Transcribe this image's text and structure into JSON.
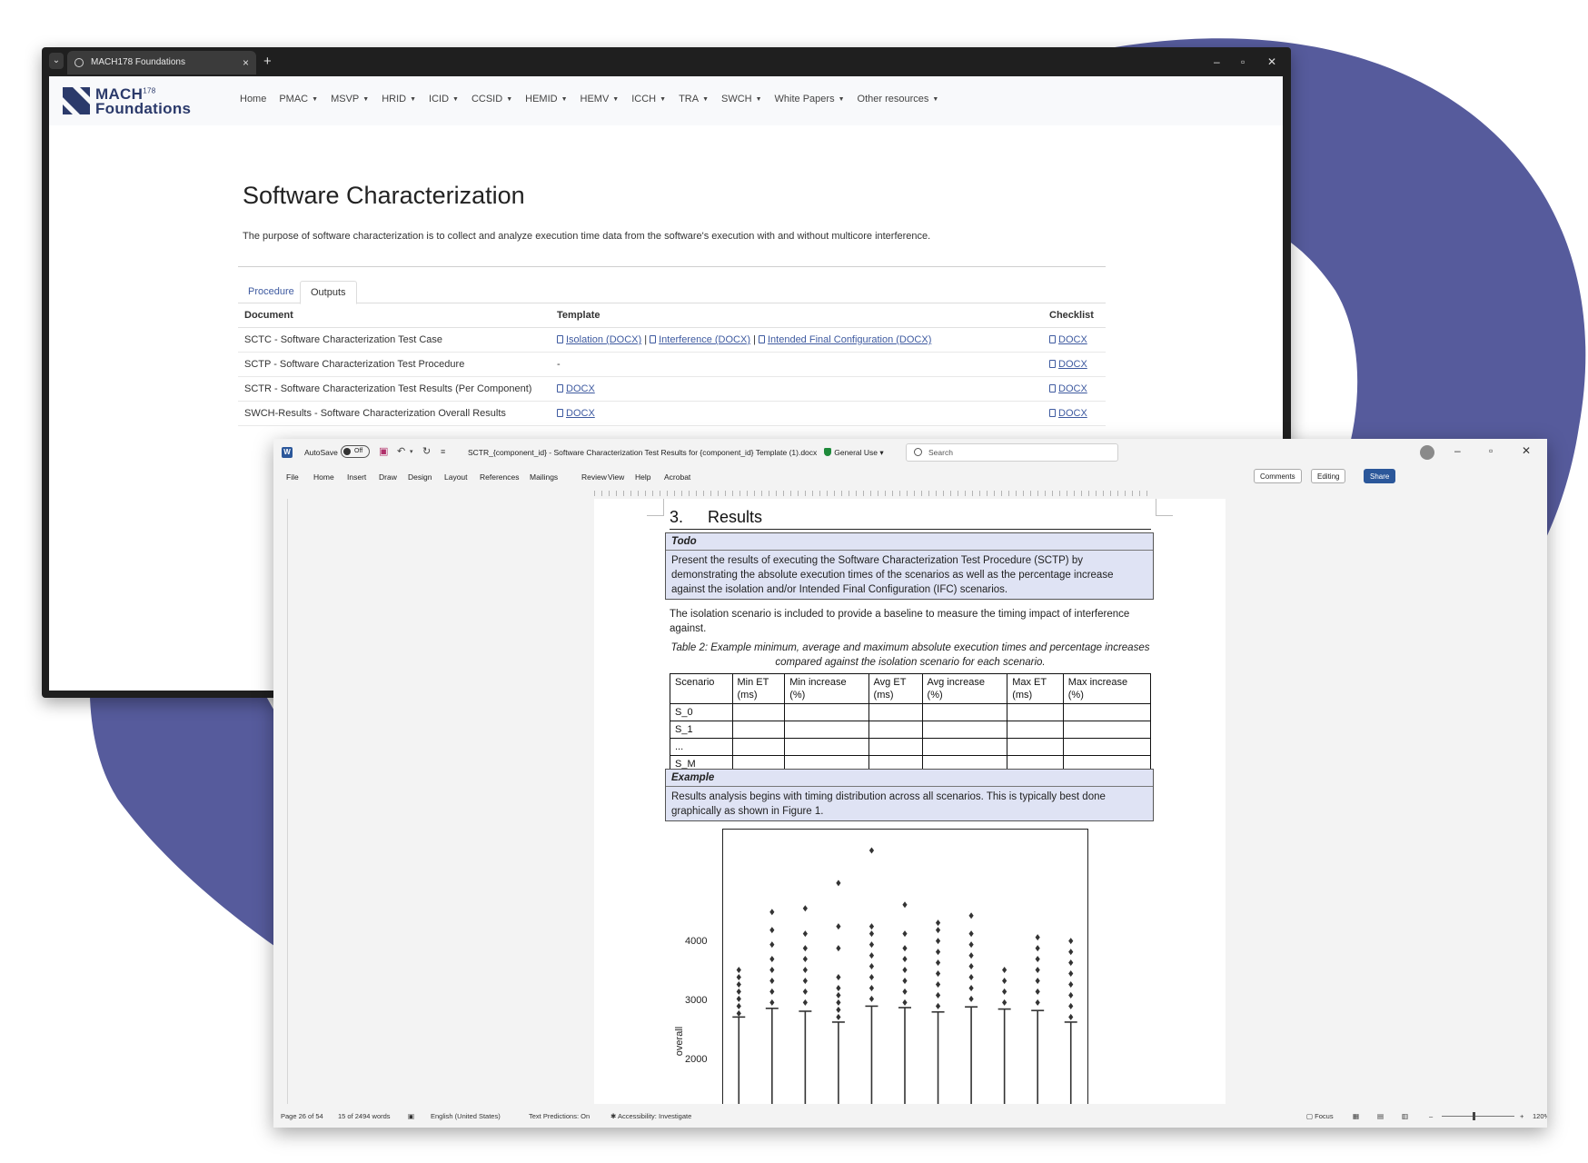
{
  "colors": {
    "decoration": "#565b9c",
    "brand": "#2b3a6b",
    "link": "#3e5aa0",
    "word_blue": "#2b579a",
    "callout_bg": "#dfe3f4"
  },
  "browser": {
    "tab_title": "MACH178 Foundations",
    "new_tab": "+",
    "controls": {
      "minimize": "–",
      "restore": "▫",
      "close": "✕"
    },
    "logo": {
      "line1": "MACH",
      "sup": "178",
      "line2": "Foundations"
    },
    "nav": [
      {
        "label": "Home",
        "dropdown": false
      },
      {
        "label": "PMAC",
        "dropdown": true
      },
      {
        "label": "MSVP",
        "dropdown": true
      },
      {
        "label": "HRID",
        "dropdown": true
      },
      {
        "label": "ICID",
        "dropdown": true
      },
      {
        "label": "CCSID",
        "dropdown": true
      },
      {
        "label": "HEMID",
        "dropdown": true
      },
      {
        "label": "HEMV",
        "dropdown": true
      },
      {
        "label": "ICCH",
        "dropdown": true
      },
      {
        "label": "TRA",
        "dropdown": true
      },
      {
        "label": "SWCH",
        "dropdown": true
      },
      {
        "label": "White Papers",
        "dropdown": true
      },
      {
        "label": "Other resources",
        "dropdown": true
      }
    ],
    "page_title": "Software Characterization",
    "description": "The purpose of software characterization is to collect and analyze execution time data from the software's execution with and without multicore interference.",
    "tabs": [
      "Procedure",
      "Outputs"
    ],
    "table": {
      "headers": [
        "Document",
        "Template",
        "Checklist"
      ],
      "rows": [
        {
          "document": "SCTC - Software Characterization Test Case",
          "templates": [
            "Isolation (DOCX)",
            "Interference (DOCX)",
            "Intended Final Configuration (DOCX)"
          ],
          "separator": "|",
          "checklist": "DOCX"
        },
        {
          "document": "SCTP - Software Characterization Test Procedure",
          "template_text": "-",
          "checklist": "DOCX"
        },
        {
          "document": "SCTR - Software Characterization Test Results (Per Component)",
          "templates": [
            "DOCX"
          ],
          "checklist": "DOCX"
        },
        {
          "document": "SWCH-Results - Software Characterization Overall Results",
          "templates": [
            "DOCX"
          ],
          "checklist": "DOCX"
        }
      ]
    }
  },
  "word": {
    "app_icon": "W",
    "autosave_label": "AutoSave",
    "autosave_state": "Off",
    "doc_title": "SCTR_{component_id} - Software Characterization Test Results for {component_id} Template (1).docx",
    "sensitivity": "General Use",
    "search_placeholder": "Search",
    "menu": [
      "File",
      "Home",
      "Insert",
      "Draw",
      "Design",
      "Layout",
      "References",
      "Mailings",
      "Review",
      "View",
      "Help",
      "Acrobat"
    ],
    "buttons": {
      "comments": "Comments",
      "editing": "Editing",
      "share": "Share"
    },
    "heading_num": "3.",
    "heading": "Results",
    "todo": {
      "title": "Todo",
      "body": "Present the results of executing the Software Characterization Test Procedure (SCTP) by demonstrating the absolute execution times of the scenarios as well as the percentage increase against the isolation and/or Intended Final Configuration (IFC) scenarios."
    },
    "paragraph": "The isolation scenario is included to provide a baseline to measure the timing impact of interference against.",
    "caption": "Table 2: Example minimum, average and maximum absolute execution times and percentage increases compared against the isolation scenario for each scenario.",
    "results_table": {
      "headers": [
        [
          "Scenario",
          ""
        ],
        [
          "Min ET",
          "(ms)"
        ],
        [
          "Min increase",
          "(%)"
        ],
        [
          "Avg ET",
          "(ms)"
        ],
        [
          "Avg increase",
          "(%)"
        ],
        [
          "Max ET",
          "(ms)"
        ],
        [
          "Max increase",
          "(%)"
        ]
      ],
      "rows": [
        "S_0",
        "S_1",
        "...",
        "S_M"
      ]
    },
    "example": {
      "title": "Example",
      "body": "Results analysis begins with timing distribution across all scenarios. This is typically best done graphically as shown in Figure 1."
    },
    "status": {
      "page": "Page 26 of 54",
      "words": "15 of 2494 words",
      "language": "English (United States)",
      "predictions": "Text Predictions: On",
      "accessibility": "Accessibility: Investigate",
      "focus": "Focus",
      "zoom": "120%"
    }
  },
  "chart_data": {
    "type": "box",
    "ylabel": "overall",
    "yticks": [
      2000,
      3000,
      4000
    ],
    "ylim": [
      1100,
      4900
    ],
    "series": [
      {
        "color": "#e8898d",
        "whisker_top": 2400,
        "outliers": [
          2450,
          2550,
          2650,
          2750,
          2850,
          2950,
          3050
        ]
      },
      {
        "color": "#e39a54",
        "whisker_top": 2520,
        "outliers": [
          2600,
          2750,
          2900,
          3050,
          3200,
          3400,
          3600,
          3850
        ]
      },
      {
        "color": "#bfa04a",
        "whisker_top": 2480,
        "outliers": [
          2600,
          2750,
          2900,
          3050,
          3200,
          3350,
          3550,
          3900
        ]
      },
      {
        "color": "#a0ae4a",
        "whisker_top": 2330,
        "outliers": [
          2400,
          2500,
          2600,
          2700,
          2800,
          2950,
          3350,
          3650,
          4250
        ]
      },
      {
        "color": "#4fb47a",
        "whisker_top": 2550,
        "outliers": [
          2650,
          2800,
          2950,
          3100,
          3250,
          3400,
          3550,
          3650,
          4700
        ]
      },
      {
        "color": "#47b5a3",
        "whisker_top": 2530,
        "outliers": [
          2600,
          2750,
          2900,
          3050,
          3200,
          3350,
          3550,
          3950
        ]
      },
      {
        "color": "#49b1c4",
        "whisker_top": 2470,
        "outliers": [
          2550,
          2700,
          2850,
          3000,
          3150,
          3300,
          3450,
          3600,
          3700
        ]
      },
      {
        "color": "#4f9fd8",
        "whisker_top": 2540,
        "outliers": [
          2650,
          2800,
          2950,
          3100,
          3250,
          3400,
          3550,
          3800
        ]
      },
      {
        "color": "#a99be0",
        "whisker_top": 2510,
        "outliers": [
          2600,
          2750,
          2900,
          3050
        ]
      },
      {
        "color": "#d48fd0",
        "whisker_top": 2490,
        "outliers": [
          2600,
          2750,
          2900,
          3050,
          3200,
          3350,
          3500
        ]
      },
      {
        "color": "#e68fb0",
        "whisker_top": 2330,
        "outliers": [
          2400,
          2550,
          2700,
          2850,
          3000,
          3150,
          3300,
          3450
        ]
      }
    ]
  }
}
